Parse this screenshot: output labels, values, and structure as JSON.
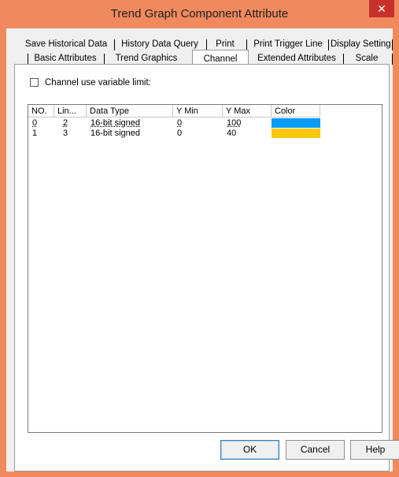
{
  "window": {
    "title": "Trend Graph Component Attribute",
    "close_glyph": "✕"
  },
  "tabs_back": [
    "Save Historical Data",
    "History Data Query",
    "Print",
    "Print Trigger Line",
    "Display Setting"
  ],
  "tabs_front": [
    "Basic Attributes",
    "Trend Graphics",
    "Channel",
    "Extended Attributes",
    "Scale"
  ],
  "active_tab": "Channel",
  "checkbox": {
    "label": "Channel use variable limit:",
    "checked": false
  },
  "table": {
    "columns": [
      "NO.",
      "Lin...",
      "Data Type",
      "Y Min",
      "Y Max",
      "Color"
    ],
    "rows": [
      {
        "no": "0",
        "line": "2",
        "type": "16-bit signed",
        "ymin": "0",
        "ymax": "100",
        "color": "#0a9df5"
      },
      {
        "no": "1",
        "line": "3",
        "type": "16-bit signed",
        "ymin": "0",
        "ymax": "40",
        "color": "#fac80a"
      }
    ]
  },
  "buttons": {
    "ok": "OK",
    "cancel": "Cancel",
    "help": "Help"
  },
  "colors": {
    "title_bar": "#f08a5e",
    "close": "#c7312a",
    "dialog_bg": "#f0f0f0"
  }
}
